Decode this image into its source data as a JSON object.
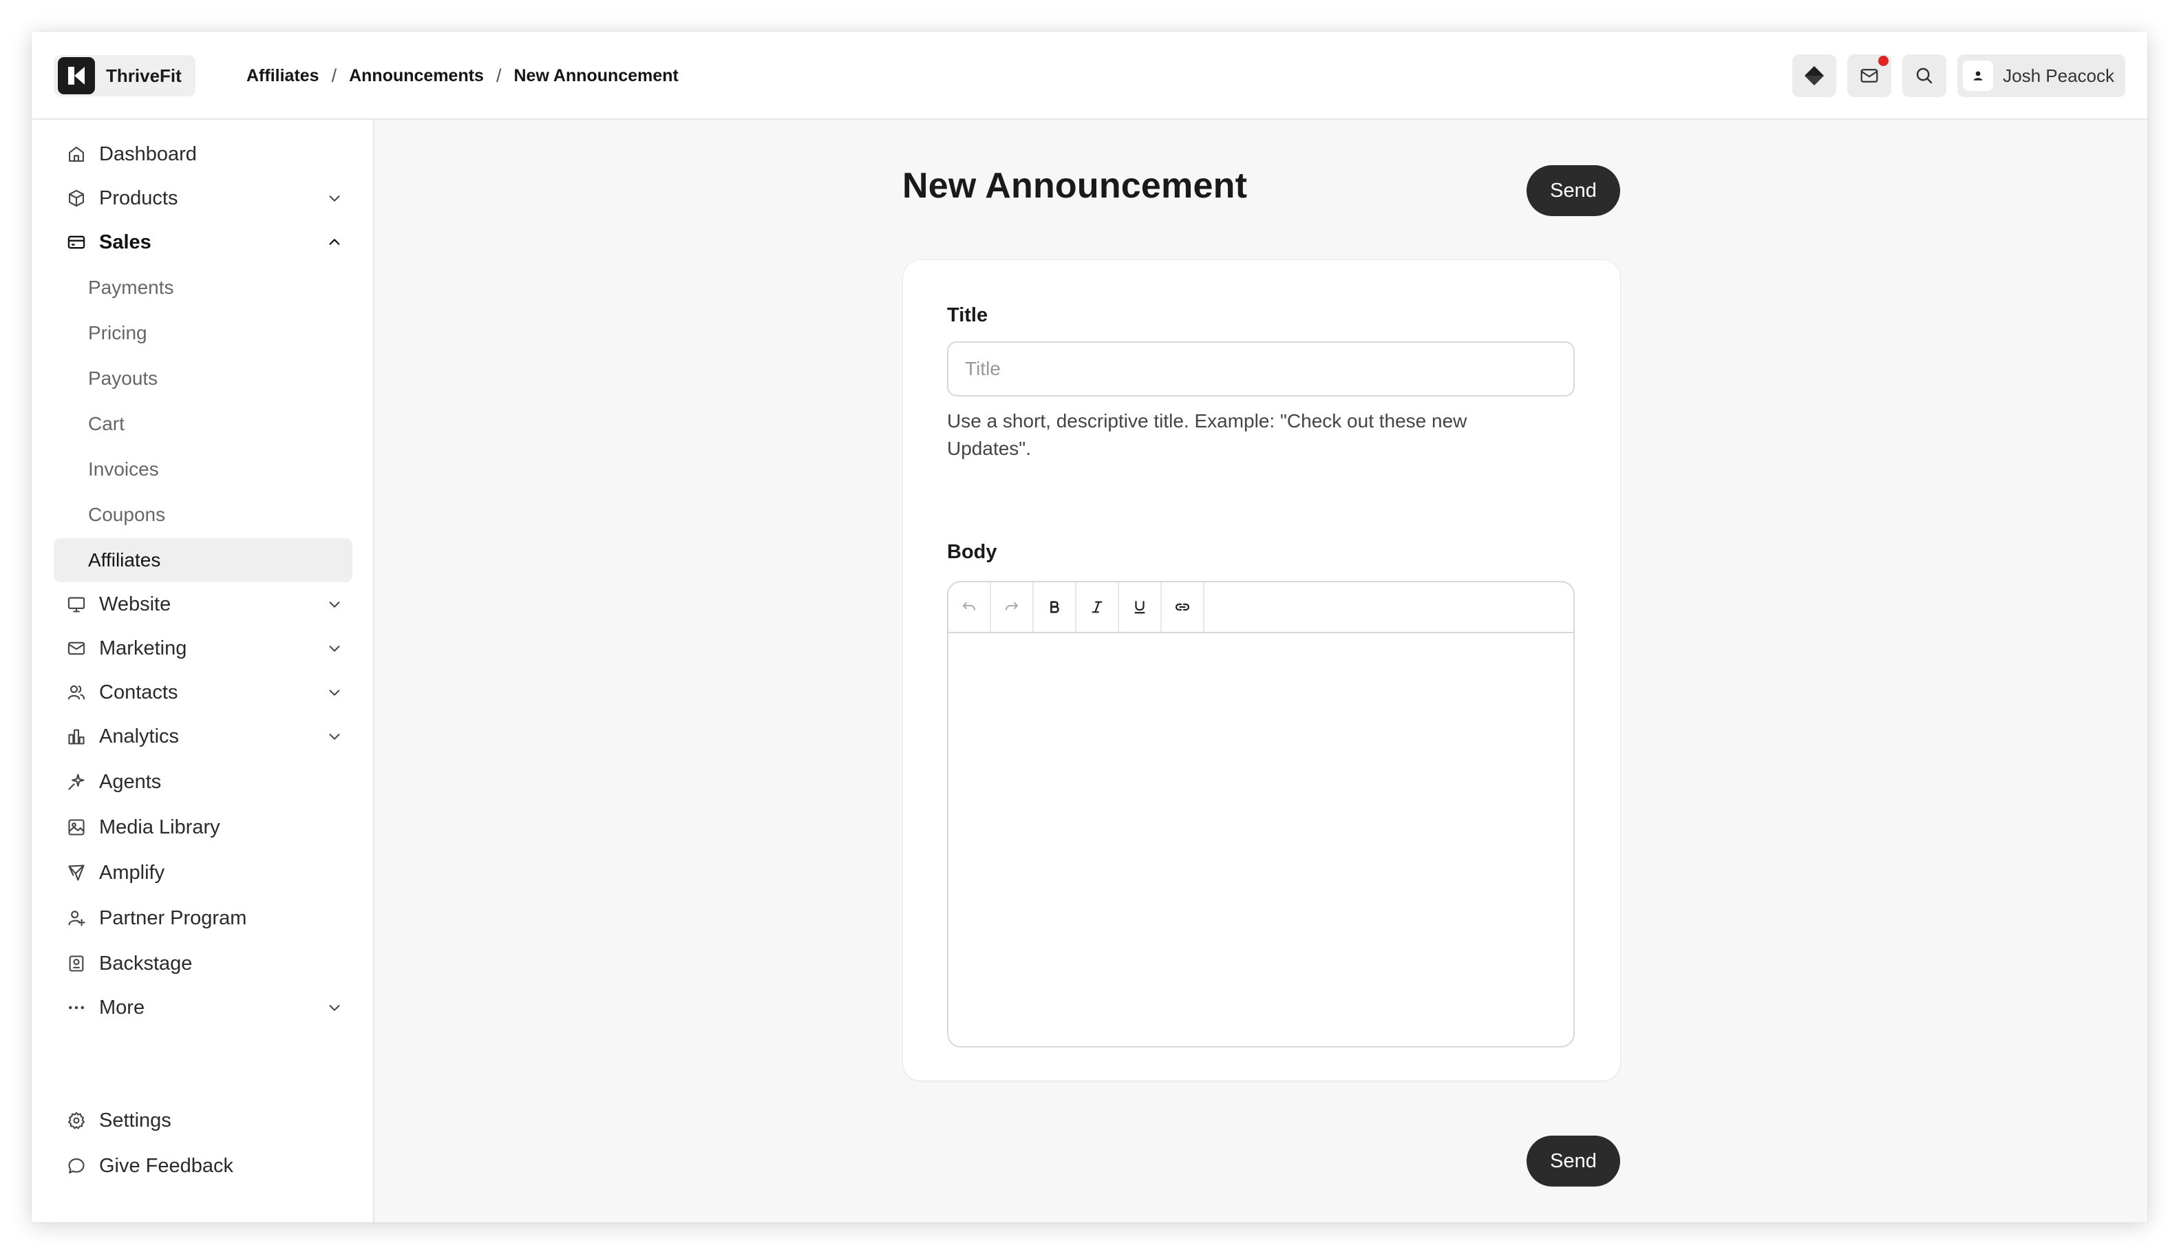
{
  "app": {
    "name": "ThriveFit"
  },
  "breadcrumb": {
    "items": [
      "Affiliates",
      "Announcements",
      "New Announcement"
    ],
    "separator": "/"
  },
  "header": {
    "user_name": "Josh Peacock",
    "icons": [
      "diamond-icon",
      "mail-icon",
      "search-icon",
      "user-icon"
    ],
    "notification_color": "#e02424"
  },
  "sidebar": {
    "items": [
      {
        "label": "Dashboard",
        "icon": "home-icon"
      },
      {
        "label": "Products",
        "icon": "box-icon",
        "expandable": true
      },
      {
        "label": "Sales",
        "icon": "credit-card-icon",
        "expanded": true
      },
      {
        "label": "Website",
        "icon": "monitor-icon",
        "expandable": true
      },
      {
        "label": "Marketing",
        "icon": "mail-icon",
        "expandable": true
      },
      {
        "label": "Contacts",
        "icon": "users-icon",
        "expandable": true
      },
      {
        "label": "Analytics",
        "icon": "bar-chart-icon",
        "expandable": true
      },
      {
        "label": "Agents",
        "icon": "sparkles-icon"
      },
      {
        "label": "Media Library",
        "icon": "image-icon"
      },
      {
        "label": "Amplify",
        "icon": "send-icon"
      },
      {
        "label": "Partner Program",
        "icon": "user-plus-icon"
      },
      {
        "label": "Backstage",
        "icon": "badge-icon"
      },
      {
        "label": "More",
        "icon": "more-icon",
        "expandable": true
      }
    ],
    "sales_children": [
      "Payments",
      "Pricing",
      "Payouts",
      "Cart",
      "Invoices",
      "Coupons",
      "Affiliates"
    ],
    "active_child": "Affiliates",
    "footer": [
      {
        "label": "Settings",
        "icon": "gear-icon"
      },
      {
        "label": "Give Feedback",
        "icon": "message-icon"
      }
    ]
  },
  "main": {
    "title": "New Announcement",
    "send_label": "Send",
    "form": {
      "title_label": "Title",
      "title_placeholder": "Title",
      "title_value": "",
      "title_helper": "Use a short, descriptive title. Example: \"Check out these new Updates\".",
      "body_label": "Body",
      "toolbar": [
        "undo-icon",
        "redo-icon",
        "bold-icon",
        "italic-icon",
        "underline-icon",
        "link-icon"
      ]
    }
  },
  "colors": {
    "primary_button": "#2b2b2b",
    "background": "#f7f7f7",
    "active_nav": "#efefef"
  }
}
